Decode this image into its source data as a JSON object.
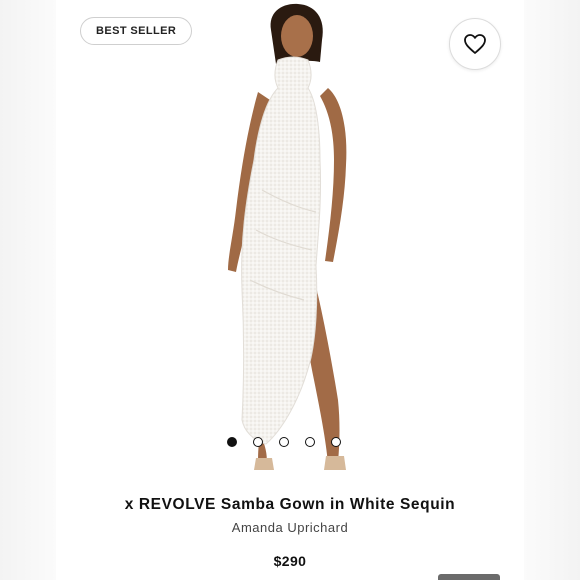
{
  "badge": {
    "label": "BEST SELLER"
  },
  "icons": {
    "wishlist": "heart-icon"
  },
  "carousel": {
    "count": 5,
    "active_index": 0
  },
  "product": {
    "title": "x REVOLVE Samba Gown in White Sequin",
    "brand": "Amanda Uprichard",
    "price": "$290"
  },
  "colors": {
    "dress": "#f4f2ee",
    "skin": "#a8704a",
    "hair": "#2a1a10",
    "text": "#111111"
  }
}
